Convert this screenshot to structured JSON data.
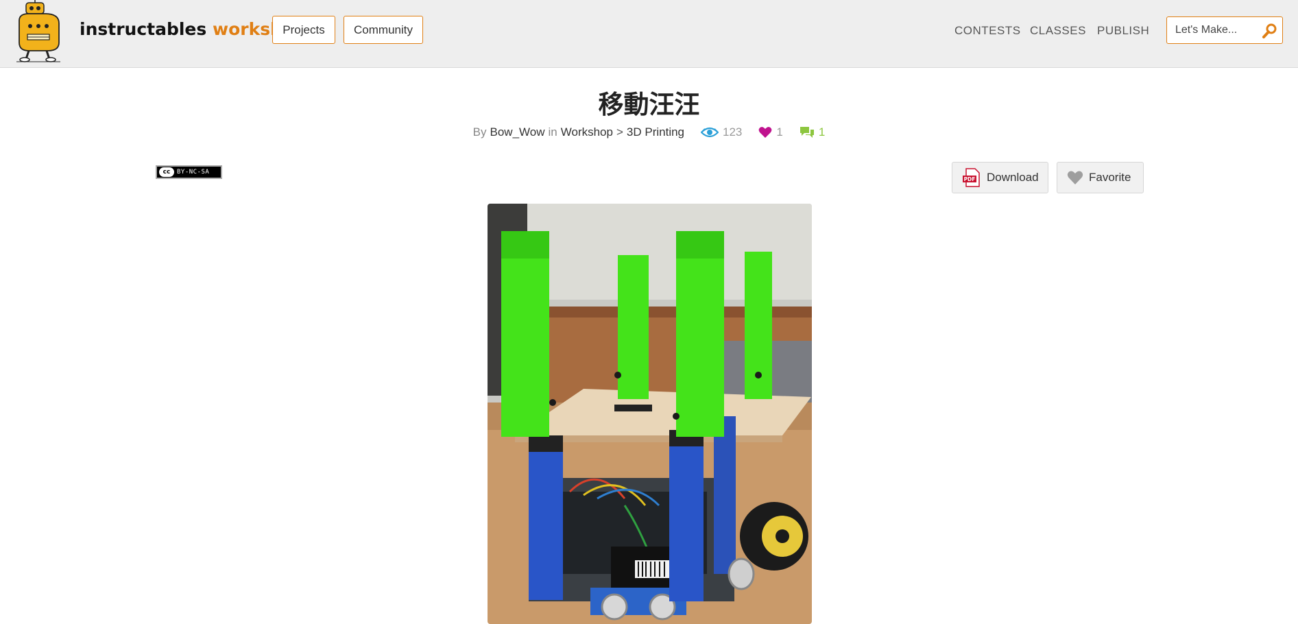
{
  "brand": {
    "part1": "instructables",
    "part2": "workshop"
  },
  "nav": {
    "projects": "Projects",
    "community": "Community"
  },
  "top_links": {
    "contests": "CONTESTS",
    "classes": "CLASSES",
    "publish": "PUBLISH"
  },
  "search": {
    "placeholder": "Let's Make..."
  },
  "article": {
    "title": "移動汪汪",
    "by": "By",
    "author": "Bow_Wow",
    "in": "in",
    "category": "Workshop",
    "separator": ">",
    "subcategory": "3D Printing",
    "views": "123",
    "favorites": "1",
    "comments": "1"
  },
  "license": {
    "badge": "cc",
    "text": "BY-NC-SA"
  },
  "actions": {
    "download": "Download",
    "favorite": "Favorite"
  },
  "colors": {
    "accent": "#e07f14",
    "views": "#2ba0d8",
    "heart": "#c0138e",
    "comments": "#8dc63f"
  },
  "icons": [
    "robot-logo-icon",
    "search-icon",
    "eye-icon",
    "heart-icon",
    "comment-icon",
    "pdf-icon",
    "heart-icon"
  ]
}
